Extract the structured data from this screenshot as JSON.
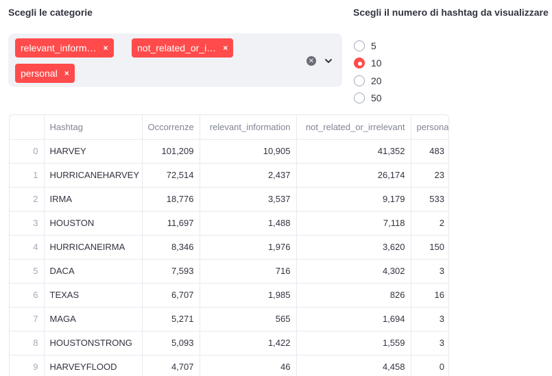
{
  "categories_label": "Scegli le categorie",
  "hashtag_count_label": "Scegli il numero di hashtag da visualizzare",
  "selected_tags": [
    "relevant_inform…",
    "not_related_or_i…",
    "personal"
  ],
  "tag_remove_glyph": "×",
  "clear_glyph": "✕",
  "radio": {
    "options": [
      "5",
      "10",
      "20",
      "50"
    ],
    "selected": "10"
  },
  "table": {
    "columns": [
      "",
      "Hashtag",
      "Occorrenze",
      "relevant_information",
      "not_related_or_irrelevant",
      "personal"
    ],
    "rows": [
      [
        "0",
        "HARVEY",
        "101,209",
        "10,905",
        "41,352",
        "483"
      ],
      [
        "1",
        "HURRICANEHARVEY",
        "72,514",
        "2,437",
        "26,174",
        "23"
      ],
      [
        "2",
        "IRMA",
        "18,776",
        "3,537",
        "9,179",
        "533"
      ],
      [
        "3",
        "HOUSTON",
        "11,697",
        "1,488",
        "7,118",
        "2"
      ],
      [
        "4",
        "HURRICANEIRMA",
        "8,346",
        "1,976",
        "3,620",
        "150"
      ],
      [
        "5",
        "DACA",
        "7,593",
        "716",
        "4,302",
        "3"
      ],
      [
        "6",
        "TEXAS",
        "6,707",
        "1,985",
        "826",
        "16"
      ],
      [
        "7",
        "MAGA",
        "5,271",
        "565",
        "1,694",
        "3"
      ],
      [
        "8",
        "HOUSTONSTRONG",
        "5,093",
        "1,422",
        "1,559",
        "3"
      ],
      [
        "9",
        "HARVEYFLOOD",
        "4,707",
        "46",
        "4,458",
        "0"
      ]
    ]
  },
  "colors": {
    "accent": "#ff4b4b",
    "select_bg": "#f0f2f6",
    "text": "#31333f",
    "muted": "#808495"
  }
}
